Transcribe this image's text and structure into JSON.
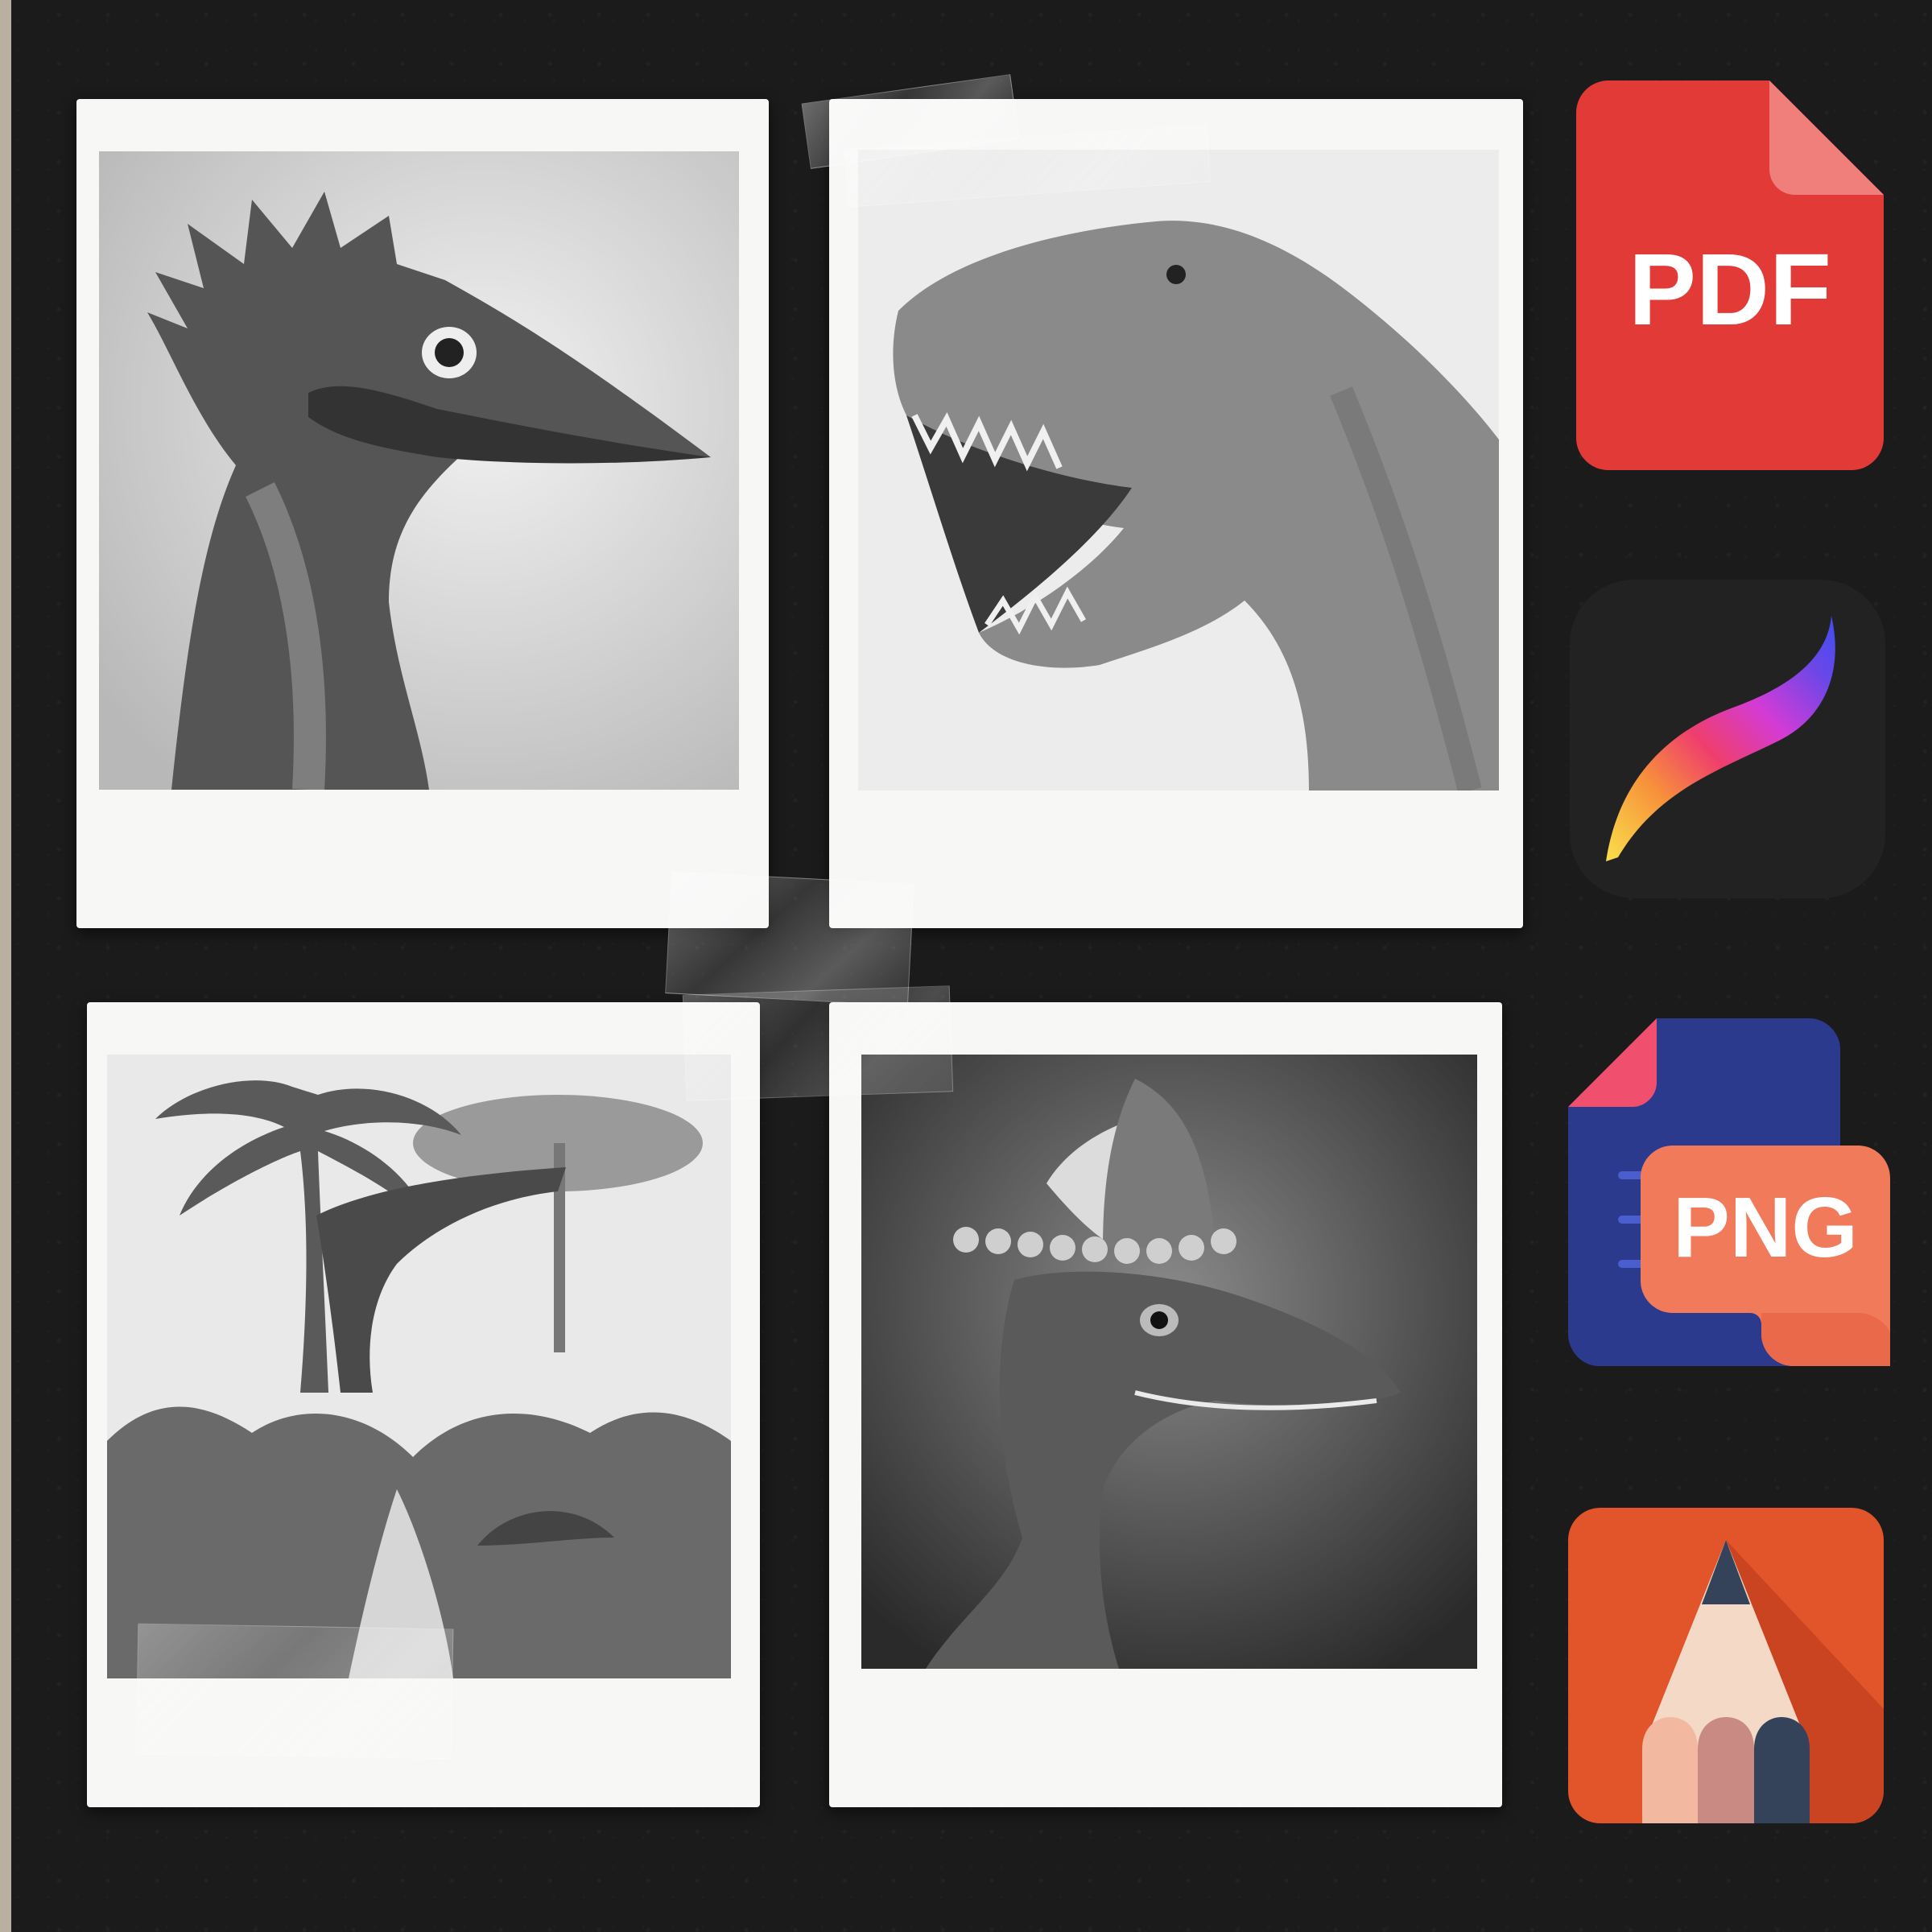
{
  "polaroids": [
    {
      "subject": "raptor-head-sketch"
    },
    {
      "subject": "t-rex-roaring-sketch"
    },
    {
      "subject": "jungle-dinosaur-scene-sketch"
    },
    {
      "subject": "crested-dinosaur-portrait-sketch"
    }
  ],
  "icons": {
    "pdf": {
      "label": "PDF",
      "color": "#e23a36"
    },
    "procreate": {
      "color": "#222222"
    },
    "png": {
      "label": "PNG",
      "color": "#2b3a8c",
      "accent": "#f07a5a"
    },
    "sketchbook": {
      "color": "#e2542a"
    }
  }
}
